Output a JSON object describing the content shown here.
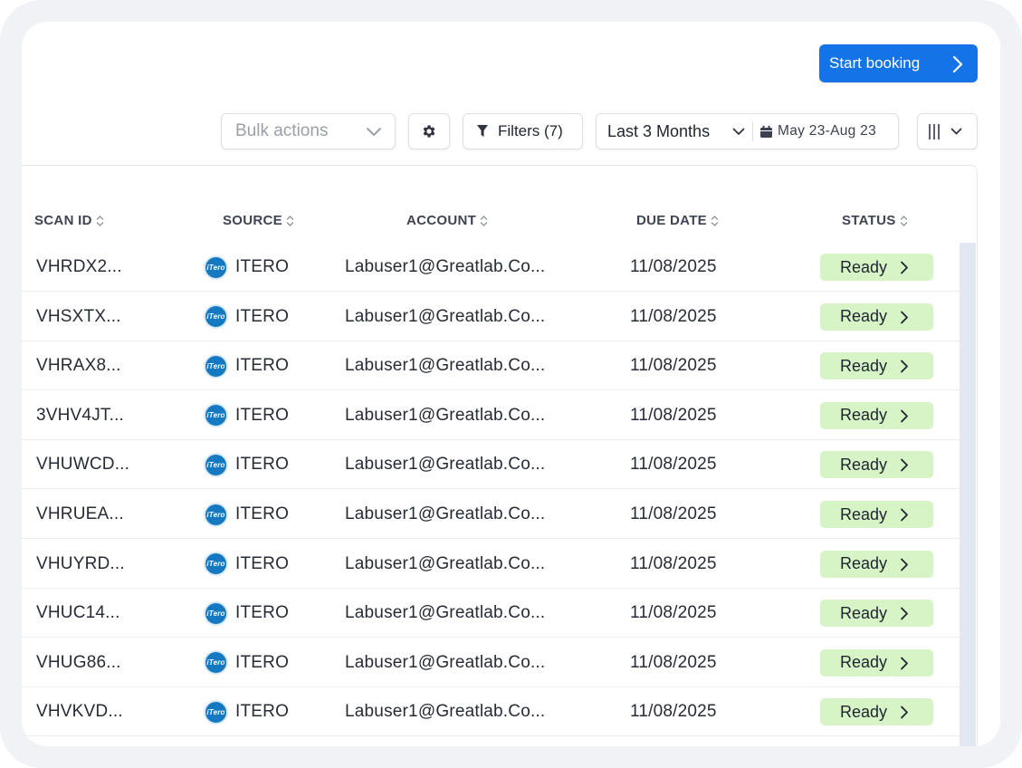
{
  "toolbar": {
    "start_booking_label": "Start booking",
    "bulk_actions_placeholder": "Bulk actions",
    "filters_label": "Filters (7)",
    "date_range_label": "Last 3 Months",
    "date_range_dates": "May 23-Aug 23"
  },
  "table": {
    "headers": {
      "scan_id": "SCAN ID",
      "source": "SOURCE",
      "account": "ACCOUNT",
      "due_date": "DUE DATE",
      "status": "STATUS"
    },
    "rows": [
      {
        "scan_id": "VHRDX2...",
        "source": "ITERO",
        "account": "Labuser1@Greatlab.Co...",
        "due_date": "11/08/2025",
        "status": "Ready"
      },
      {
        "scan_id": "VHSXTX...",
        "source": "ITERO",
        "account": "Labuser1@Greatlab.Co...",
        "due_date": "11/08/2025",
        "status": "Ready"
      },
      {
        "scan_id": "VHRAX8...",
        "source": "ITERO",
        "account": "Labuser1@Greatlab.Co...",
        "due_date": "11/08/2025",
        "status": "Ready"
      },
      {
        "scan_id": "3VHV4JT...",
        "source": "ITERO",
        "account": "Labuser1@Greatlab.Co...",
        "due_date": "11/08/2025",
        "status": "Ready"
      },
      {
        "scan_id": "VHUWCD...",
        "source": "ITERO",
        "account": "Labuser1@Greatlab.Co...",
        "due_date": "11/08/2025",
        "status": "Ready"
      },
      {
        "scan_id": "VHRUEA...",
        "source": "ITERO",
        "account": "Labuser1@Greatlab.Co...",
        "due_date": "11/08/2025",
        "status": "Ready"
      },
      {
        "scan_id": "VHUYRD...",
        "source": "ITERO",
        "account": "Labuser1@Greatlab.Co...",
        "due_date": "11/08/2025",
        "status": "Ready"
      },
      {
        "scan_id": "VHUC14...",
        "source": "ITERO",
        "account": "Labuser1@Greatlab.Co...",
        "due_date": "11/08/2025",
        "status": "Ready"
      },
      {
        "scan_id": "VHUG86...",
        "source": "ITERO",
        "account": "Labuser1@Greatlab.Co...",
        "due_date": "11/08/2025",
        "status": "Ready"
      },
      {
        "scan_id": "VHVKVD...",
        "source": "ITERO",
        "account": "Labuser1@Greatlab.Co...",
        "due_date": "11/08/2025",
        "status": "Ready"
      }
    ]
  },
  "icons": {
    "source_logo": "itero-logo",
    "settings": "gear-icon",
    "filter": "funnel-icon",
    "calendar": "calendar-icon",
    "columns": "columns-icon"
  },
  "colors": {
    "primary": "#1473e6",
    "status_ready_bg": "#d6f4c6",
    "itero_blue": "#1579c2"
  }
}
